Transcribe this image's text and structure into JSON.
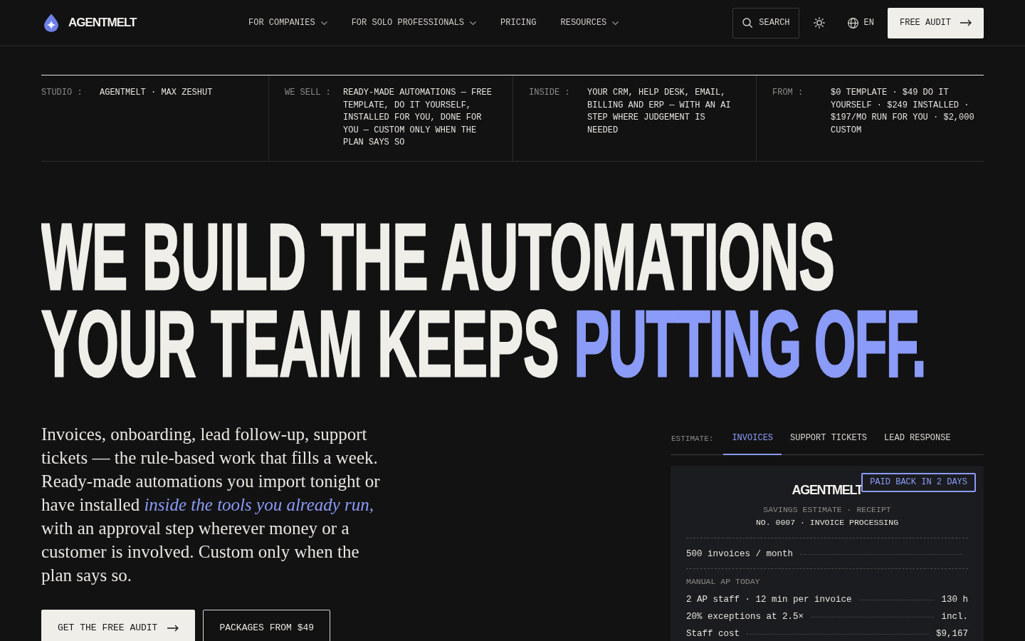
{
  "header": {
    "brand": "AGENTMELT",
    "nav": [
      {
        "label": "FOR COMPANIES",
        "dropdown": true
      },
      {
        "label": "FOR SOLO PROFESSIONALS",
        "dropdown": true
      },
      {
        "label": "PRICING",
        "dropdown": false
      },
      {
        "label": "RESOURCES",
        "dropdown": true
      }
    ],
    "search": "SEARCH",
    "language": "EN",
    "cta": "FREE AUDIT"
  },
  "facts": [
    {
      "label": "STUDIO :",
      "value": "AGENTMELT · MAX ZESHUT"
    },
    {
      "label": "WE SELL :",
      "value": "READY-MADE AUTOMATIONS — FREE TEMPLATE, DO IT YOURSELF, INSTALLED FOR YOU, DONE FOR YOU — CUSTOM ONLY WHEN THE PLAN SAYS SO"
    },
    {
      "label": "INSIDE :",
      "value": "YOUR CRM, HELP DESK, EMAIL, BILLING AND ERP — WITH AN AI STEP WHERE JUDGEMENT IS NEEDED"
    },
    {
      "label": "FROM :",
      "value": "$0 TEMPLATE · $49 DO IT YOURSELF · $249 INSTALLED · $197/MO RUN FOR YOU · $2,000 CUSTOM"
    }
  ],
  "hero": {
    "headline": "WE BUILD THE AUTOMATIONS YOUR TEAM KEEPS",
    "highlight": "PUTTING OFF.",
    "intro": "Invoices, onboarding, lead follow-up, support tickets — the rule-based work that fills a week. Ready-made automations you import tonight or have installed *inside the tools you already run,* with an approval step wherever money or a customer is involved. Custom only when the plan says so.",
    "buttons": [
      {
        "label": "GET THE FREE AUDIT",
        "kind": "primary"
      },
      {
        "label": "PACKAGES FROM $49",
        "kind": "secondary"
      }
    ]
  },
  "estimate": {
    "label": "ESTIMATE:",
    "tabs": [
      {
        "label": "INVOICES",
        "selected": true
      },
      {
        "label": "SUPPORT TICKETS",
        "selected": false
      },
      {
        "label": "LEAD RESPONSE",
        "selected": false
      }
    ],
    "receipt": {
      "brand": "AGENTMELT",
      "badge": "PAID BACK IN 2 DAYS",
      "subtitle": "SAVINGS ESTIMATE · RECEIPT",
      "number": "NO. 0007 · INVOICE PROCESSING",
      "sections": [
        {
          "lines": [
            {
              "label": "500 invoices / month"
            }
          ]
        },
        {
          "heading": "MANUAL AP TODAY",
          "lines": [
            {
              "label": "2 AP staff · 12 min per invoice",
              "value": "130 h"
            },
            {
              "label": "20% exceptions at 2.5×",
              "value": "incl."
            },
            {
              "label": "Staff cost",
              "value": "$9,167"
            }
          ]
        }
      ]
    }
  }
}
